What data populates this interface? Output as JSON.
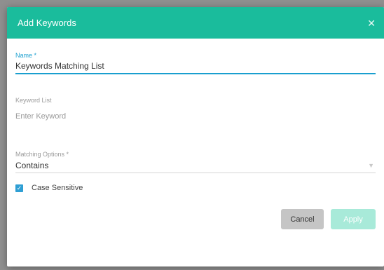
{
  "dialog": {
    "title": "Add Keywords",
    "close_glyph": "✕"
  },
  "form": {
    "name": {
      "label": "Name *",
      "value": "Keywords Matching List"
    },
    "keyword_list": {
      "label": "Keyword List",
      "placeholder": "Enter Keyword"
    },
    "matching_options": {
      "label": "Matching Options *",
      "value": "Contains"
    },
    "case_sensitive": {
      "label": "Case Sensitive",
      "checked": true
    }
  },
  "actions": {
    "cancel_label": "Cancel",
    "apply_label": "Apply"
  },
  "colors": {
    "header": "#1abc9c",
    "accent": "#1a9fcf",
    "apply_disabled": "#a8ead9",
    "cancel": "#c5c5c5"
  }
}
